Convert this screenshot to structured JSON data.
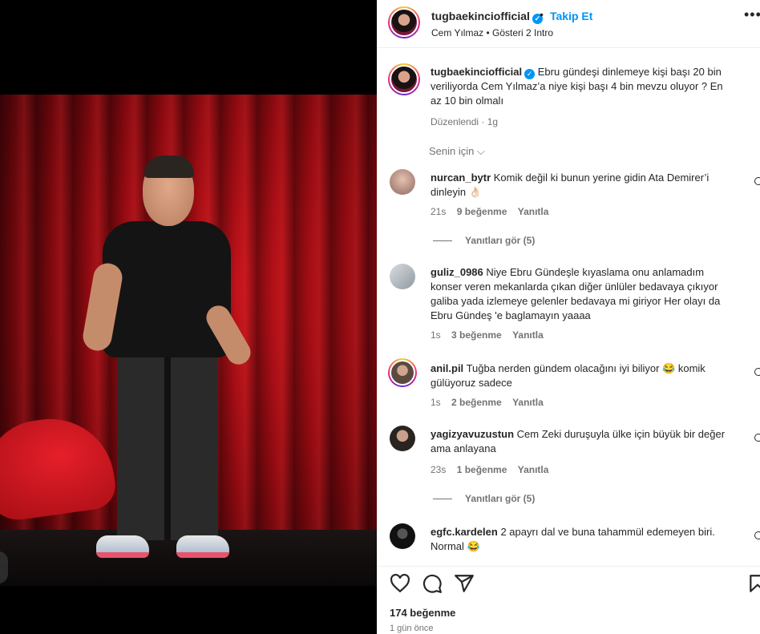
{
  "post": {
    "username": "tugbaekinciofficial",
    "follow_label": "Takip Et",
    "dot": "•",
    "subtitle": "Cem Yılmaz • Gösteri 2 Intro",
    "more": "•••"
  },
  "caption": {
    "username": "tugbaekinciofficial",
    "text": "Ebru gündeşi dinlemeye kişi başı 20 bin veriliyorda Cem Yılmaz’a niye kişi başı 4 bin mevzu oluyor ? En az 10 bin olmalı",
    "meta": "Düzenlendi · 1g"
  },
  "filter": {
    "label": "Senin için"
  },
  "comments": [
    {
      "username": "nurcan_bytr",
      "text": "Komik değil ki bunun yerine gidin Ata Demirer’i dinleyin 👌🏻",
      "time": "21s",
      "likes": "9 beğenme",
      "reply": "Yanıtla",
      "view_replies": "Yanıtları gör (5)"
    },
    {
      "username": "guliz_0986",
      "text": "Niye Ebru Gündeşle kıyaslama onu anlamadım konser veren mekanlarda çıkan diğer ünlüler bedavaya çıkıyor galiba yada izlemeye gelenler bedavaya mi giriyor Her olayı da Ebru Gündeş 'e baglamayın yaaaa",
      "time": "1s",
      "likes": "3 beğenme",
      "reply": "Yanıtla"
    },
    {
      "username": "anil.pil",
      "text": "Tuğba nerden gündem olacağını iyi biliyor 😂 komik gülüyoruz sadece",
      "time": "1s",
      "likes": "2 beğenme",
      "reply": "Yanıtla"
    },
    {
      "username": "yagizyavuzustun",
      "text": "Cem Zeki duruşuyla ülke için büyük bir değer ama anlayana",
      "time": "23s",
      "likes": "1 beğenme",
      "reply": "Yanıtla",
      "view_replies": "Yanıtları gör (5)"
    },
    {
      "username": "egfc.kardelen",
      "text": "2 apayrı dal ve buna tahammül edemeyen biri. Normal 😂"
    }
  ],
  "footer": {
    "likes": "174 beğenme",
    "date": "1 gün önce"
  },
  "icons": [
    "heart-icon",
    "comment-icon",
    "share-icon",
    "bookmark-icon",
    "verified-icon",
    "chevron-down-icon",
    "more-icon"
  ],
  "colors": {
    "accent": "#0095f6",
    "text": "#262626",
    "muted": "#737373",
    "curtain": "#b3121a"
  }
}
